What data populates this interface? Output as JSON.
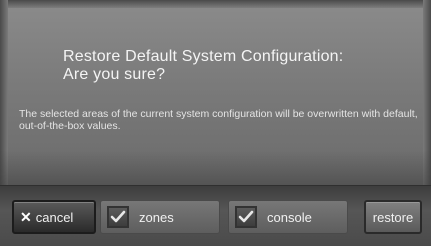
{
  "dialog": {
    "title_line1": "Restore Default System Configuration:",
    "title_line2": "Are you sure?",
    "message": "The selected areas of the current system configuration will be overwritten with default, out-of-the-box values."
  },
  "toolbar": {
    "cancel_label": "cancel",
    "cancel_icon": "x-icon",
    "zones": {
      "label": "zones",
      "checked": true
    },
    "console": {
      "label": "console",
      "checked": true
    },
    "restore_label": "restore"
  },
  "colors": {
    "background": "#7a7a7a",
    "toolbar": "#4a4a4a",
    "text": "#f2f2f2"
  }
}
